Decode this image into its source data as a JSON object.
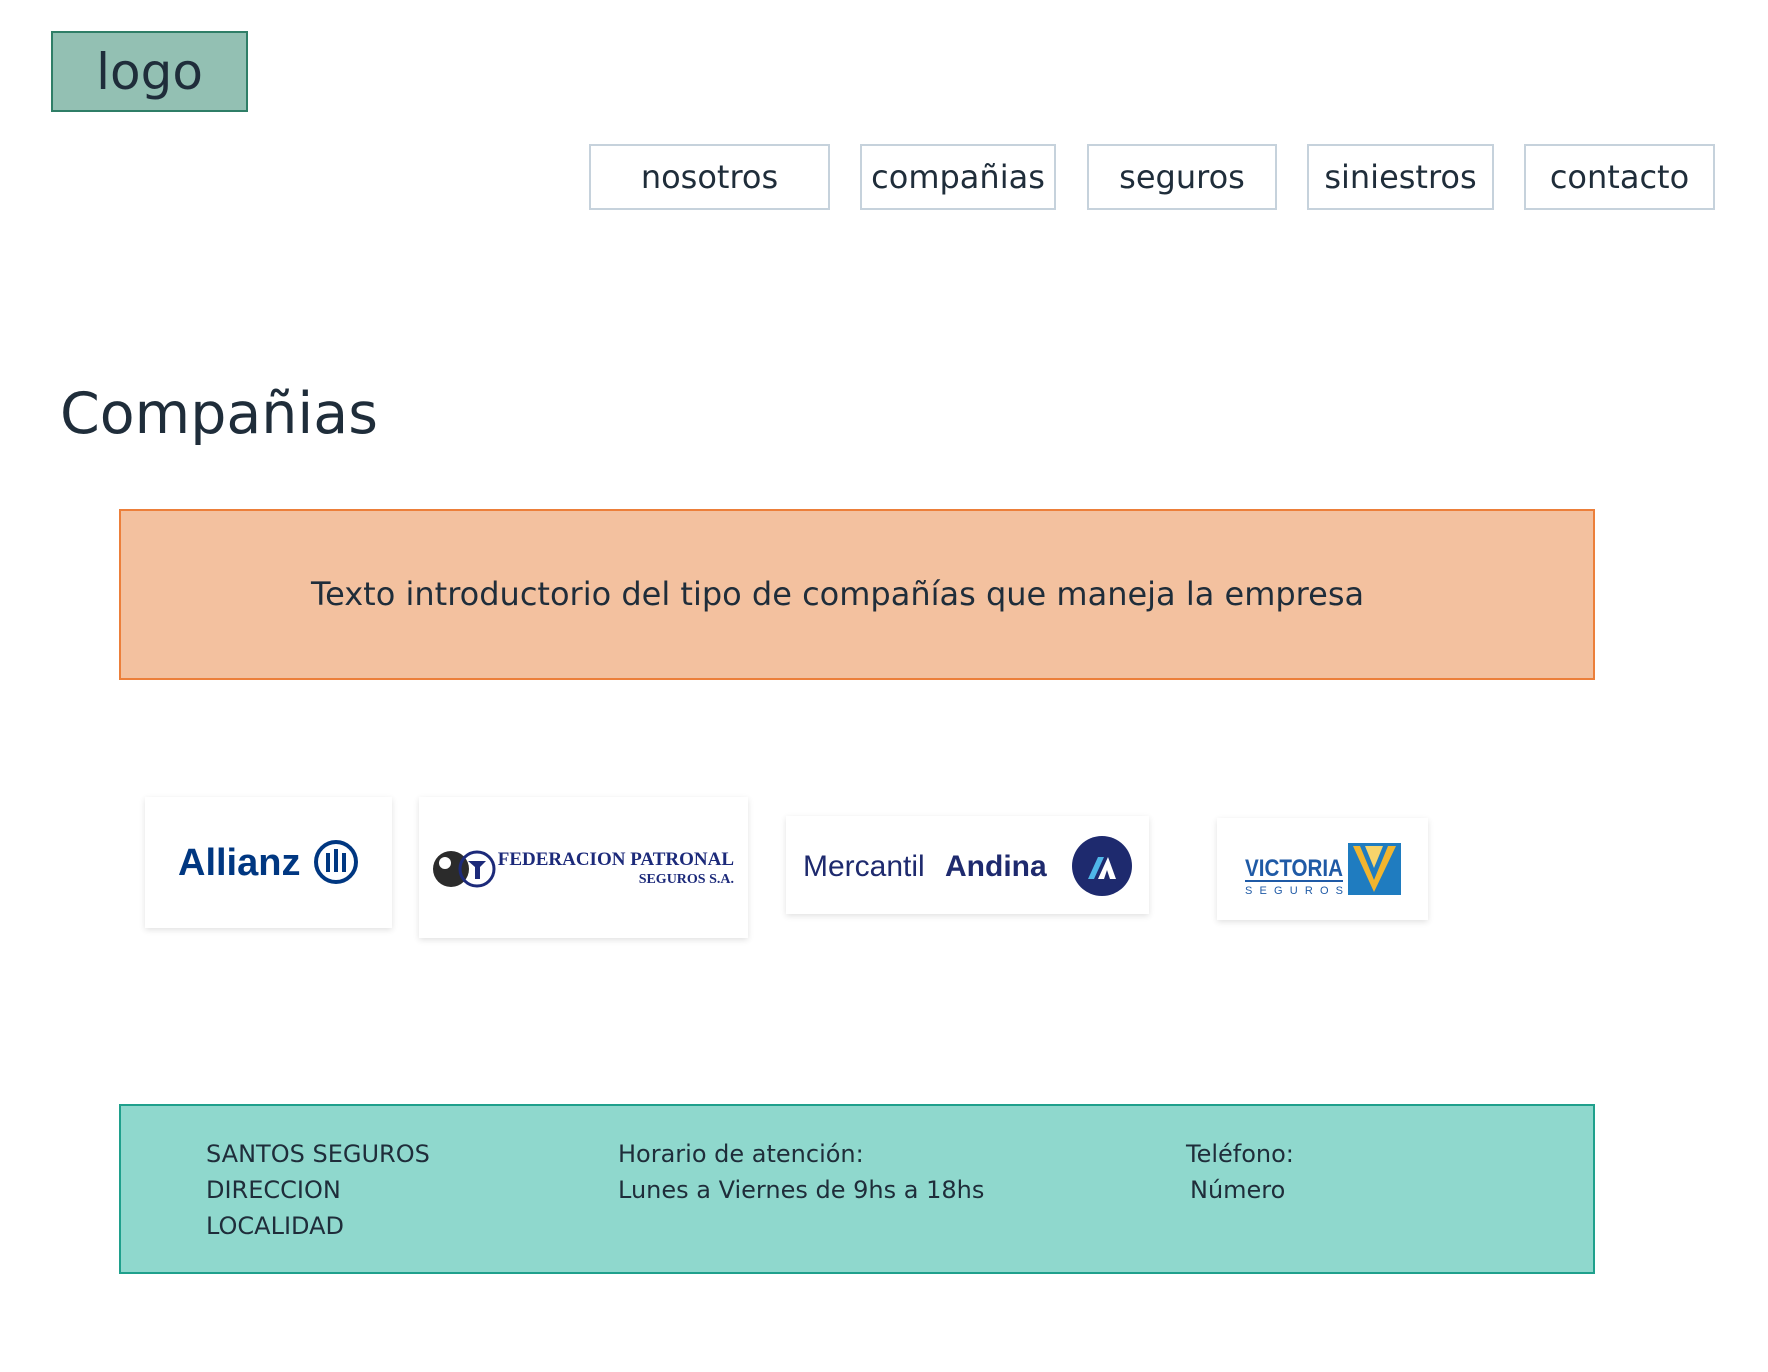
{
  "header": {
    "logo_label": "logo",
    "nav": [
      {
        "label": "nosotros"
      },
      {
        "label": "compañias"
      },
      {
        "label": "seguros"
      },
      {
        "label": "siniestros"
      },
      {
        "label": "contacto"
      }
    ]
  },
  "main": {
    "title": "Compañias",
    "intro": "Texto introductorio del tipo de compañías que maneja la empresa",
    "companies": [
      {
        "name": "Allianz",
        "logo_text": "Allianz",
        "icon": "allianz-logo-icon",
        "color": "#003781"
      },
      {
        "name": "Federacion Patronal",
        "logo_text": "FEDERACION PATRONAL",
        "logo_subtext": "SEGUROS S.A.",
        "icon": "federacion-patronal-logo-icon",
        "color": "#1c2a7a"
      },
      {
        "name": "Mercantil Andina",
        "logo_text": "Mercantil",
        "logo_text_bold": "Andina",
        "icon": "mercantil-andina-logo-icon",
        "color": "#1e2a6e"
      },
      {
        "name": "Victoria Seguros",
        "logo_text": "VICTORIA",
        "logo_subtext": "SEGUROS",
        "icon": "victoria-seguros-logo-icon",
        "color": "#1f5aa6"
      }
    ]
  },
  "footer": {
    "company_lines": [
      "SANTOS SEGUROS",
      "DIRECCION",
      "LOCALIDAD"
    ],
    "hours_label": "Horario de atención:",
    "hours_value": "Lunes a Viernes de 9hs a 18hs",
    "phone_label": "Teléfono:",
    "phone_value": "Número"
  },
  "colors": {
    "logo_bg": "#93c0b3",
    "intro_bg": "#f3c19f",
    "intro_border": "#ec7f3a",
    "footer_bg": "#8fd8cd",
    "footer_border": "#1fa08c"
  }
}
